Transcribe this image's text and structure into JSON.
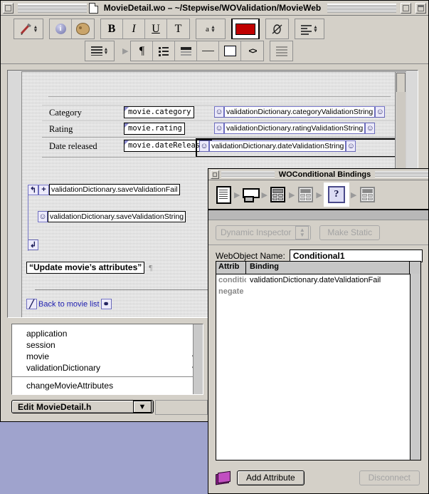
{
  "main_window": {
    "title": "MovieDetail.wo  –  ~/Stepwise/WOValidation/MovieWeb",
    "close_button": "close",
    "zoom_button": "zoom",
    "collapse_button": "collapse"
  },
  "toolbar": {
    "row1": [
      {
        "name": "brush-icon",
        "label": ""
      },
      {
        "name": "info-icon",
        "label": "i"
      },
      {
        "name": "palette-icon",
        "label": ""
      },
      {
        "name": "bold-icon",
        "label": "B"
      },
      {
        "name": "italic-icon",
        "label": "I"
      },
      {
        "name": "underline-icon",
        "label": "U"
      },
      {
        "name": "text-style-icon",
        "label": "T"
      },
      {
        "name": "font-size-icon",
        "label": "a"
      },
      {
        "name": "color-swatch-icon",
        "label": ""
      },
      {
        "name": "link-icon",
        "label": ""
      },
      {
        "name": "align-icon",
        "label": ""
      }
    ],
    "row2": [
      {
        "name": "form-elements-icon",
        "label": ""
      },
      {
        "name": "paragraph-icon",
        "label": "¶"
      },
      {
        "name": "list-icon",
        "label": ""
      },
      {
        "name": "block-icon",
        "label": ""
      },
      {
        "name": "horizontal-rule-icon",
        "label": ""
      },
      {
        "name": "box-icon",
        "label": ""
      },
      {
        "name": "raw-html-icon",
        "label": "<>"
      },
      {
        "name": "table-icon",
        "label": ""
      }
    ],
    "color_swatch": "#c00000"
  },
  "document": {
    "rows": [
      {
        "label": "Category",
        "binding": "movie.category",
        "validation": "validationDictionary.categoryValidationString"
      },
      {
        "label": "Rating",
        "binding": "movie.rating",
        "validation": "validationDictionary.ratingValidationString"
      },
      {
        "label": "Date released",
        "binding": "movie.dateReleased",
        "validation": "validationDictionary.dateValidationString"
      }
    ],
    "conditional": {
      "open_tag_icon": "conditional-start-icon",
      "plus_icon": "plus-icon",
      "open_binding": "validationDictionary.saveValidationFail",
      "inner_string": "validationDictionary.saveValidationString",
      "close_tag_icon": "conditional-end-icon"
    },
    "submit_button_label": "“Update movie’s attributes”",
    "pilcrow": "¶",
    "back_link": "Back to movie list"
  },
  "variable_list": {
    "items": [
      {
        "label": "application",
        "has_children": false
      },
      {
        "label": "session",
        "has_children": false
      },
      {
        "label": "movie",
        "has_children": true
      },
      {
        "label": "validationDictionary",
        "has_children": true
      }
    ],
    "methods": [
      "changeMovieAttributes"
    ],
    "chevron": "┳"
  },
  "popup": {
    "label": "Edit MovieDetail.h",
    "arrow": "▼"
  },
  "inspector": {
    "title": "WOConditional Bindings",
    "close_button": "close",
    "path_icons": [
      {
        "name": "document-path-icon"
      },
      {
        "name": "window-path-icon"
      },
      {
        "name": "table-path-icon"
      },
      {
        "name": "table-selected-path-icon"
      },
      {
        "name": "conditional-question-icon",
        "label": "?"
      },
      {
        "name": "table-end-path-icon"
      }
    ],
    "path_separator": "▶",
    "dynamic_inspector_label": "Dynamic Inspector",
    "make_static_label": "Make Static",
    "webobject_name_label": "WebObject Name:",
    "webobject_name_value": "Conditional1",
    "table": {
      "headers": [
        "Attrib",
        "Binding"
      ],
      "rows": [
        {
          "attrib": "condition",
          "binding": "validationDictionary.dateValidationFail"
        },
        {
          "attrib": "negate",
          "binding": ""
        }
      ]
    },
    "book_icon": "book-icon",
    "add_attribute_label": "Add Attribute",
    "disconnect_label": "Disconnect"
  },
  "colors": {
    "desktop": "#9fa3cd",
    "chrome": "#d4d0c8",
    "accent_blue": "#6d6dbe",
    "link": "#2020b0",
    "swatch_red": "#c00000"
  }
}
